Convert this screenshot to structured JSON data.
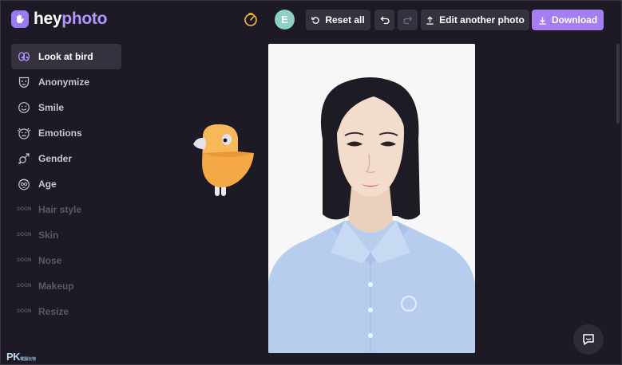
{
  "app": {
    "brand_left": "hey",
    "brand_right": "photo"
  },
  "header": {
    "avatar_initial": "E",
    "reset_label": "Reset all",
    "edit_label": "Edit another photo",
    "download_label": "Download",
    "accent_color": "#a57ff0"
  },
  "sidebar": {
    "items": [
      {
        "label": "Look at bird",
        "icon": "eyes-icon",
        "active": true
      },
      {
        "label": "Anonymize",
        "icon": "mask-icon"
      },
      {
        "label": "Smile",
        "icon": "smile-icon"
      },
      {
        "label": "Emotions",
        "icon": "emotions-icon"
      },
      {
        "label": "Gender",
        "icon": "gender-icon"
      },
      {
        "label": "Age",
        "icon": "age-icon"
      },
      {
        "label": "Hair style",
        "soon": "SOON"
      },
      {
        "label": "Skin",
        "soon": "SOON"
      },
      {
        "label": "Nose",
        "soon": "SOON"
      },
      {
        "label": "Makeup",
        "soon": "SOON"
      },
      {
        "label": "Resize",
        "soon": "SOON"
      }
    ]
  },
  "watermark": {
    "text": "PK",
    "sub": "電腦玩物"
  }
}
